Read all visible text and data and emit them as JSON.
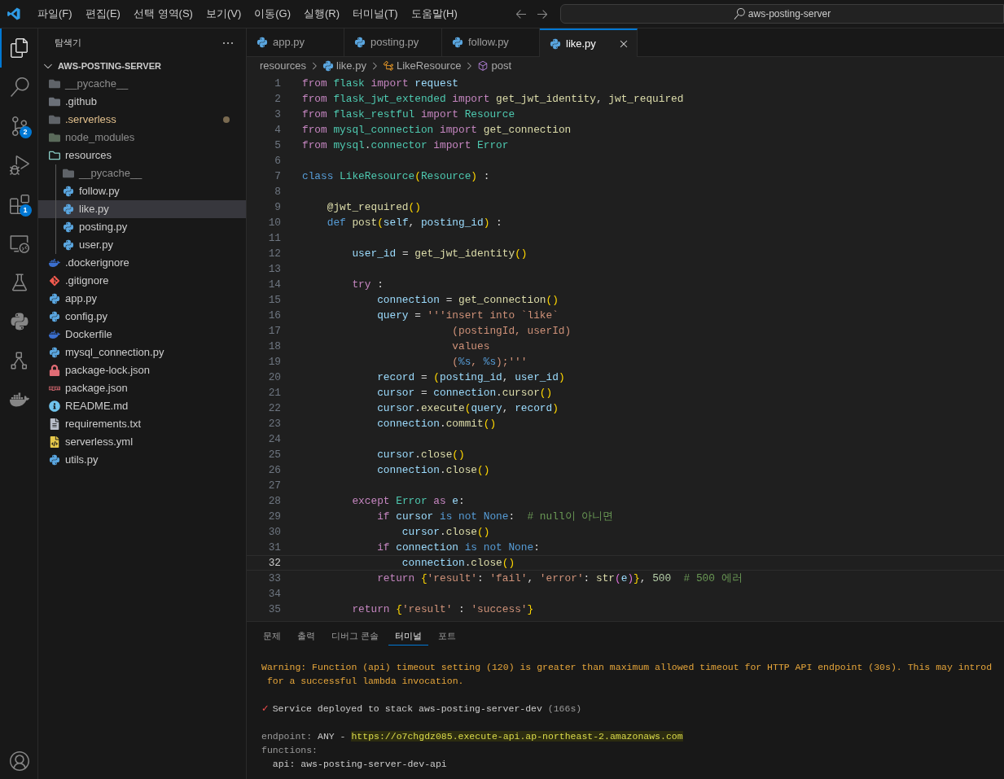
{
  "menu": [
    "파일(F)",
    "편집(E)",
    "선택 영역(S)",
    "보기(V)",
    "이동(G)",
    "실행(R)",
    "터미널(T)",
    "도움말(H)"
  ],
  "command_center": "aws-posting-server",
  "activity_bar": [
    {
      "selected": true
    },
    {
      "selected": false
    },
    {
      "selected": false,
      "badge": "2"
    },
    {
      "selected": false
    },
    {
      "selected": false,
      "badge": "1"
    },
    {
      "selected": false
    },
    {
      "selected": false
    },
    {
      "selected": false
    },
    {
      "selected": false
    },
    {
      "selected": false
    },
    {
      "selected": false
    }
  ],
  "explorer": {
    "title": "탐색기",
    "section": "AWS-POSTING-SERVER",
    "items": [
      {
        "name": "__pycache__",
        "kind": "folder",
        "selected": false,
        "dimmed": true
      },
      {
        "name": ".github",
        "kind": "folder-github",
        "selected": false,
        "dimmed": false
      },
      {
        "name": ".serverless",
        "kind": "folder",
        "selected": false,
        "dimmed": false,
        "modified": true
      },
      {
        "name": "node_modules",
        "kind": "folder-node",
        "selected": false,
        "dimmed": true
      },
      {
        "name": "resources",
        "kind": "folder-open",
        "selected": false,
        "dimmed": false,
        "children": [
          {
            "name": "__pycache__",
            "kind": "folder",
            "selected": false,
            "dimmed": true
          },
          {
            "name": "follow.py",
            "kind": "python",
            "selected": false,
            "dimmed": false
          },
          {
            "name": "like.py",
            "kind": "python",
            "selected": true,
            "dimmed": false
          },
          {
            "name": "posting.py",
            "kind": "python",
            "selected": false,
            "dimmed": false
          },
          {
            "name": "user.py",
            "kind": "python",
            "selected": false,
            "dimmed": false
          }
        ]
      },
      {
        "name": ".dockerignore",
        "kind": "docker",
        "selected": false,
        "dimmed": false
      },
      {
        "name": ".gitignore",
        "kind": "git",
        "selected": false,
        "dimmed": false
      },
      {
        "name": "app.py",
        "kind": "python",
        "selected": false,
        "dimmed": false
      },
      {
        "name": "config.py",
        "kind": "python",
        "selected": false,
        "dimmed": false
      },
      {
        "name": "Dockerfile",
        "kind": "docker",
        "selected": false,
        "dimmed": false
      },
      {
        "name": "mysql_connection.py",
        "kind": "python",
        "selected": false,
        "dimmed": false
      },
      {
        "name": "package-lock.json",
        "kind": "lock",
        "selected": false,
        "dimmed": false
      },
      {
        "name": "package.json",
        "kind": "npm",
        "selected": false,
        "dimmed": false
      },
      {
        "name": "README.md",
        "kind": "info",
        "selected": false,
        "dimmed": false
      },
      {
        "name": "requirements.txt",
        "kind": "text",
        "selected": false,
        "dimmed": false
      },
      {
        "name": "serverless.yml",
        "kind": "yaml",
        "selected": false,
        "dimmed": false
      },
      {
        "name": "utils.py",
        "kind": "python",
        "selected": false,
        "dimmed": false
      }
    ]
  },
  "tabs": [
    {
      "label": "app.py",
      "selected": false
    },
    {
      "label": "posting.py",
      "selected": false
    },
    {
      "label": "follow.py",
      "selected": false
    },
    {
      "label": "like.py",
      "selected": true
    }
  ],
  "breadcrumb": [
    {
      "label": "resources",
      "kind": "folder"
    },
    {
      "label": "like.py",
      "kind": "python"
    },
    {
      "label": "LikeResource",
      "kind": "class"
    },
    {
      "label": "post",
      "kind": "method"
    }
  ],
  "code": [
    {
      "n": "1",
      "current": false,
      "tokens": [
        {
          "text": "from ",
          "kind": "kw"
        },
        {
          "text": "flask ",
          "kind": "mod"
        },
        {
          "text": "import ",
          "kind": "kw"
        },
        {
          "text": "request",
          "kind": "var"
        }
      ]
    },
    {
      "n": "2",
      "current": false,
      "tokens": [
        {
          "text": "from ",
          "kind": "kw"
        },
        {
          "text": "flask_jwt_extended ",
          "kind": "mod"
        },
        {
          "text": "import ",
          "kind": "kw"
        },
        {
          "text": "get_jwt_identity",
          "kind": "fn"
        },
        {
          "text": ", ",
          "kind": "p"
        },
        {
          "text": "jwt_required",
          "kind": "fn"
        }
      ]
    },
    {
      "n": "3",
      "current": false,
      "tokens": [
        {
          "text": "from ",
          "kind": "kw"
        },
        {
          "text": "flask_restful ",
          "kind": "mod"
        },
        {
          "text": "import ",
          "kind": "kw"
        },
        {
          "text": "Resource",
          "kind": "mod"
        }
      ]
    },
    {
      "n": "4",
      "current": false,
      "tokens": [
        {
          "text": "from ",
          "kind": "kw"
        },
        {
          "text": "mysql_connection ",
          "kind": "mod"
        },
        {
          "text": "import ",
          "kind": "kw"
        },
        {
          "text": "get_connection",
          "kind": "fn"
        }
      ]
    },
    {
      "n": "5",
      "current": false,
      "tokens": [
        {
          "text": "from ",
          "kind": "kw"
        },
        {
          "text": "mysql",
          "kind": "mod"
        },
        {
          "text": ".",
          "kind": "p"
        },
        {
          "text": "connector ",
          "kind": "mod"
        },
        {
          "text": "import ",
          "kind": "kw"
        },
        {
          "text": "Error",
          "kind": "mod"
        }
      ]
    },
    {
      "n": "6",
      "current": false
    },
    {
      "n": "7",
      "current": false,
      "tokens": [
        {
          "text": "class ",
          "kind": "st"
        },
        {
          "text": "LikeResource",
          "kind": "mod"
        },
        {
          "text": "(",
          "kind": "b1"
        },
        {
          "text": "Resource",
          "kind": "mod"
        },
        {
          "text": ")",
          "kind": "b1"
        },
        {
          "text": " :",
          "kind": "p"
        }
      ]
    },
    {
      "n": "8",
      "current": false
    },
    {
      "n": "9",
      "current": false,
      "tokens": [
        {
          "text": "    @jwt_required",
          "kind": "fn"
        },
        {
          "text": "()",
          "kind": "b1"
        }
      ]
    },
    {
      "n": "10",
      "current": false,
      "tokens": [
        {
          "text": "    def ",
          "kind": "st"
        },
        {
          "text": "post",
          "kind": "fn"
        },
        {
          "text": "(",
          "kind": "b1"
        },
        {
          "text": "self",
          "kind": "var"
        },
        {
          "text": ", ",
          "kind": "p"
        },
        {
          "text": "posting_id",
          "kind": "var"
        },
        {
          "text": ")",
          "kind": "b1"
        },
        {
          "text": " :",
          "kind": "p"
        }
      ]
    },
    {
      "n": "11",
      "current": false
    },
    {
      "n": "12",
      "current": false,
      "tokens": [
        {
          "text": "        user_id",
          "kind": "var"
        },
        {
          "text": " = ",
          "kind": "p"
        },
        {
          "text": "get_jwt_identity",
          "kind": "fn"
        },
        {
          "text": "()",
          "kind": "b1"
        }
      ]
    },
    {
      "n": "13",
      "current": false
    },
    {
      "n": "14",
      "current": false,
      "tokens": [
        {
          "text": "        try",
          "kind": "kw"
        },
        {
          "text": " :",
          "kind": "p"
        }
      ]
    },
    {
      "n": "15",
      "current": false,
      "tokens": [
        {
          "text": "            connection",
          "kind": "var"
        },
        {
          "text": " = ",
          "kind": "p"
        },
        {
          "text": "get_connection",
          "kind": "fn"
        },
        {
          "text": "()",
          "kind": "b1"
        }
      ]
    },
    {
      "n": "16",
      "current": false,
      "tokens": [
        {
          "text": "            query",
          "kind": "var"
        },
        {
          "text": " = ",
          "kind": "p"
        },
        {
          "text": "'''insert into `like`",
          "kind": "str"
        }
      ]
    },
    {
      "n": "17",
      "current": false,
      "tokens": [
        {
          "text": "                        (postingId, userId)",
          "kind": "str"
        }
      ]
    },
    {
      "n": "18",
      "current": false,
      "tokens": [
        {
          "text": "                        values",
          "kind": "str"
        }
      ]
    },
    {
      "n": "19",
      "current": false,
      "tokens": [
        {
          "text": "                        (",
          "kind": "str"
        },
        {
          "text": "%s",
          "kind": "st"
        },
        {
          "text": ", ",
          "kind": "str"
        },
        {
          "text": "%s",
          "kind": "st"
        },
        {
          "text": ");'''",
          "kind": "str"
        }
      ]
    },
    {
      "n": "20",
      "current": false,
      "tokens": [
        {
          "text": "            record",
          "kind": "var"
        },
        {
          "text": " = ",
          "kind": "p"
        },
        {
          "text": "(",
          "kind": "b1"
        },
        {
          "text": "posting_id",
          "kind": "var"
        },
        {
          "text": ", ",
          "kind": "p"
        },
        {
          "text": "user_id",
          "kind": "var"
        },
        {
          "text": ")",
          "kind": "b1"
        }
      ]
    },
    {
      "n": "21",
      "current": false,
      "tokens": [
        {
          "text": "            cursor",
          "kind": "var"
        },
        {
          "text": " = ",
          "kind": "p"
        },
        {
          "text": "connection",
          "kind": "var"
        },
        {
          "text": ".",
          "kind": "p"
        },
        {
          "text": "cursor",
          "kind": "fn"
        },
        {
          "text": "()",
          "kind": "b1"
        }
      ]
    },
    {
      "n": "22",
      "current": false,
      "tokens": [
        {
          "text": "            cursor",
          "kind": "var"
        },
        {
          "text": ".",
          "kind": "p"
        },
        {
          "text": "execute",
          "kind": "fn"
        },
        {
          "text": "(",
          "kind": "b1"
        },
        {
          "text": "query",
          "kind": "var"
        },
        {
          "text": ", ",
          "kind": "p"
        },
        {
          "text": "record",
          "kind": "var"
        },
        {
          "text": ")",
          "kind": "b1"
        }
      ]
    },
    {
      "n": "23",
      "current": false,
      "tokens": [
        {
          "text": "            connection",
          "kind": "var"
        },
        {
          "text": ".",
          "kind": "p"
        },
        {
          "text": "commit",
          "kind": "fn"
        },
        {
          "text": "()",
          "kind": "b1"
        }
      ]
    },
    {
      "n": "24",
      "current": false
    },
    {
      "n": "25",
      "current": false,
      "tokens": [
        {
          "text": "            cursor",
          "kind": "var"
        },
        {
          "text": ".",
          "kind": "p"
        },
        {
          "text": "close",
          "kind": "fn"
        },
        {
          "text": "()",
          "kind": "b1"
        }
      ]
    },
    {
      "n": "26",
      "current": false,
      "tokens": [
        {
          "text": "            connection",
          "kind": "var"
        },
        {
          "text": ".",
          "kind": "p"
        },
        {
          "text": "close",
          "kind": "fn"
        },
        {
          "text": "()",
          "kind": "b1"
        }
      ]
    },
    {
      "n": "27",
      "current": false
    },
    {
      "n": "28",
      "current": false,
      "tokens": [
        {
          "text": "        except ",
          "kind": "kw"
        },
        {
          "text": "Error",
          "kind": "mod"
        },
        {
          "text": " as ",
          "kind": "kw"
        },
        {
          "text": "e",
          "kind": "var"
        },
        {
          "text": ":",
          "kind": "p"
        }
      ]
    },
    {
      "n": "29",
      "current": false,
      "tokens": [
        {
          "text": "            if ",
          "kind": "kw"
        },
        {
          "text": "cursor",
          "kind": "var"
        },
        {
          "text": " is not None",
          "kind": "st"
        },
        {
          "text": ":  ",
          "kind": "p"
        },
        {
          "text": "# null이 아니면",
          "kind": "cmt"
        }
      ]
    },
    {
      "n": "30",
      "current": false,
      "tokens": [
        {
          "text": "                cursor",
          "kind": "var"
        },
        {
          "text": ".",
          "kind": "p"
        },
        {
          "text": "close",
          "kind": "fn"
        },
        {
          "text": "()",
          "kind": "b1"
        }
      ]
    },
    {
      "n": "31",
      "current": false,
      "tokens": [
        {
          "text": "            if ",
          "kind": "kw"
        },
        {
          "text": "connection",
          "kind": "var"
        },
        {
          "text": " is not None",
          "kind": "st"
        },
        {
          "text": ":",
          "kind": "p"
        }
      ]
    },
    {
      "n": "32",
      "current": true,
      "tokens": [
        {
          "text": "                connection",
          "kind": "var"
        },
        {
          "text": ".",
          "kind": "p"
        },
        {
          "text": "close",
          "kind": "fn"
        },
        {
          "text": "()",
          "kind": "b1"
        }
      ]
    },
    {
      "n": "33",
      "current": false,
      "tokens": [
        {
          "text": "            return ",
          "kind": "kw"
        },
        {
          "text": "{",
          "kind": "b1"
        },
        {
          "text": "'result'",
          "kind": "str"
        },
        {
          "text": ": ",
          "kind": "p"
        },
        {
          "text": "'fail'",
          "kind": "str"
        },
        {
          "text": ", ",
          "kind": "p"
        },
        {
          "text": "'error'",
          "kind": "str"
        },
        {
          "text": ": ",
          "kind": "p"
        },
        {
          "text": "str",
          "kind": "fn"
        },
        {
          "text": "(",
          "kind": "b2"
        },
        {
          "text": "e",
          "kind": "var"
        },
        {
          "text": ")",
          "kind": "b2"
        },
        {
          "text": "}",
          "kind": "b1"
        },
        {
          "text": ", ",
          "kind": "p"
        },
        {
          "text": "500",
          "kind": "num"
        },
        {
          "text": "  # 500 에러",
          "kind": "cmt"
        }
      ]
    },
    {
      "n": "34",
      "current": false
    },
    {
      "n": "35",
      "current": false,
      "tokens": [
        {
          "text": "        return ",
          "kind": "kw"
        },
        {
          "text": "{",
          "kind": "b1"
        },
        {
          "text": "'result'",
          "kind": "str"
        },
        {
          "text": " : ",
          "kind": "p"
        },
        {
          "text": "'success'",
          "kind": "str"
        },
        {
          "text": "}",
          "kind": "b1"
        }
      ]
    }
  ],
  "panel": {
    "tabs": [
      {
        "label": "문제",
        "selected": false
      },
      {
        "label": "출력",
        "selected": false
      },
      {
        "label": "디버그 콘솔",
        "selected": false
      },
      {
        "label": "터미널",
        "selected": true
      },
      {
        "label": "포트",
        "selected": false
      }
    ],
    "lines": [
      {
        "kind": "text",
        "segments": [
          {
            "text": "Warning: Function (api) timeout setting (120) is greater than maximum allowed timeout for HTTP API endpoint (30s). This may introd",
            "kind": "warn"
          }
        ]
      },
      {
        "kind": "text",
        "segments": [
          {
            "text": " for a successful lambda invocation.",
            "kind": "warn"
          }
        ]
      },
      {
        "kind": "blank"
      },
      {
        "kind": "text",
        "segments": [
          {
            "text": "✓",
            "kind": "check"
          },
          {
            "text": "Service deployed to stack aws-posting-server-dev",
            "kind": "plain"
          },
          {
            "text": " (166s)",
            "kind": "dim"
          }
        ]
      },
      {
        "kind": "blank"
      },
      {
        "kind": "text",
        "segments": [
          {
            "text": "endpoint: ",
            "kind": "dim"
          },
          {
            "text": "ANY - ",
            "kind": "plain"
          },
          {
            "text": "https://o7chgdz085.execute-api.ap-northeast-2.amazonaws.com",
            "kind": "url"
          }
        ]
      },
      {
        "kind": "text",
        "segments": [
          {
            "text": "functions:",
            "kind": "dim"
          }
        ]
      },
      {
        "kind": "text",
        "segments": [
          {
            "text": "  api: aws-posting-server-dev-api",
            "kind": "plain"
          }
        ]
      }
    ]
  }
}
